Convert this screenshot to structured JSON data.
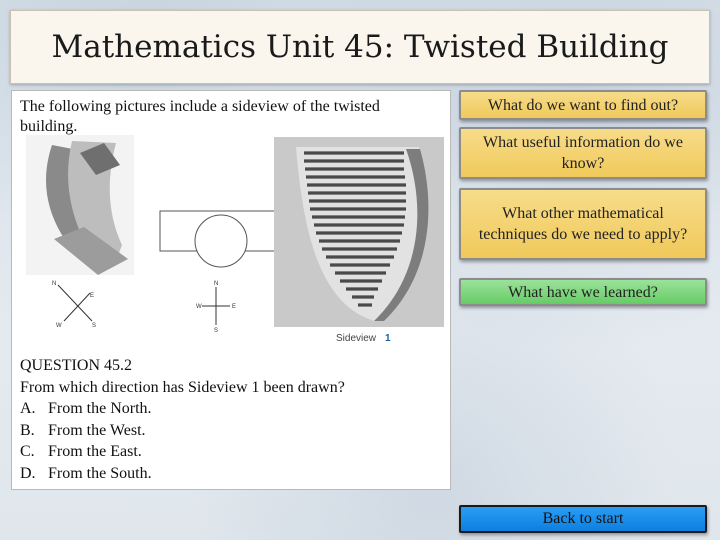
{
  "title": "Mathematics Unit 45: Twisted Building",
  "intro": "The following pictures include a sideview of the twisted building.",
  "figure": {
    "caption_text": "Sideview",
    "caption_number": "1",
    "compass_a": {
      "n": "N",
      "e": "E",
      "s": "S",
      "w": "W"
    },
    "compass_b": {
      "n": "N",
      "e": "E",
      "s": "S",
      "w": "W"
    }
  },
  "question": {
    "heading": "QUESTION 45.2",
    "prompt": "From which direction has Sideview 1 been drawn?",
    "options": [
      {
        "letter": "A.",
        "text": "From the North."
      },
      {
        "letter": "B.",
        "text": "From the West."
      },
      {
        "letter": "C.",
        "text": "From the East."
      },
      {
        "letter": "D.",
        "text": "From the South."
      }
    ]
  },
  "nav": {
    "find_out": "What do we want to find out?",
    "useful_info": "What useful information do we know?",
    "techniques": "What other mathematical techniques do we need to apply?",
    "learned": "What have we learned?",
    "back": "Back to start"
  },
  "colors": {
    "nav_yellow": "#f0c95a",
    "nav_green": "#66cc66",
    "back_blue": "#0d7fe0"
  }
}
